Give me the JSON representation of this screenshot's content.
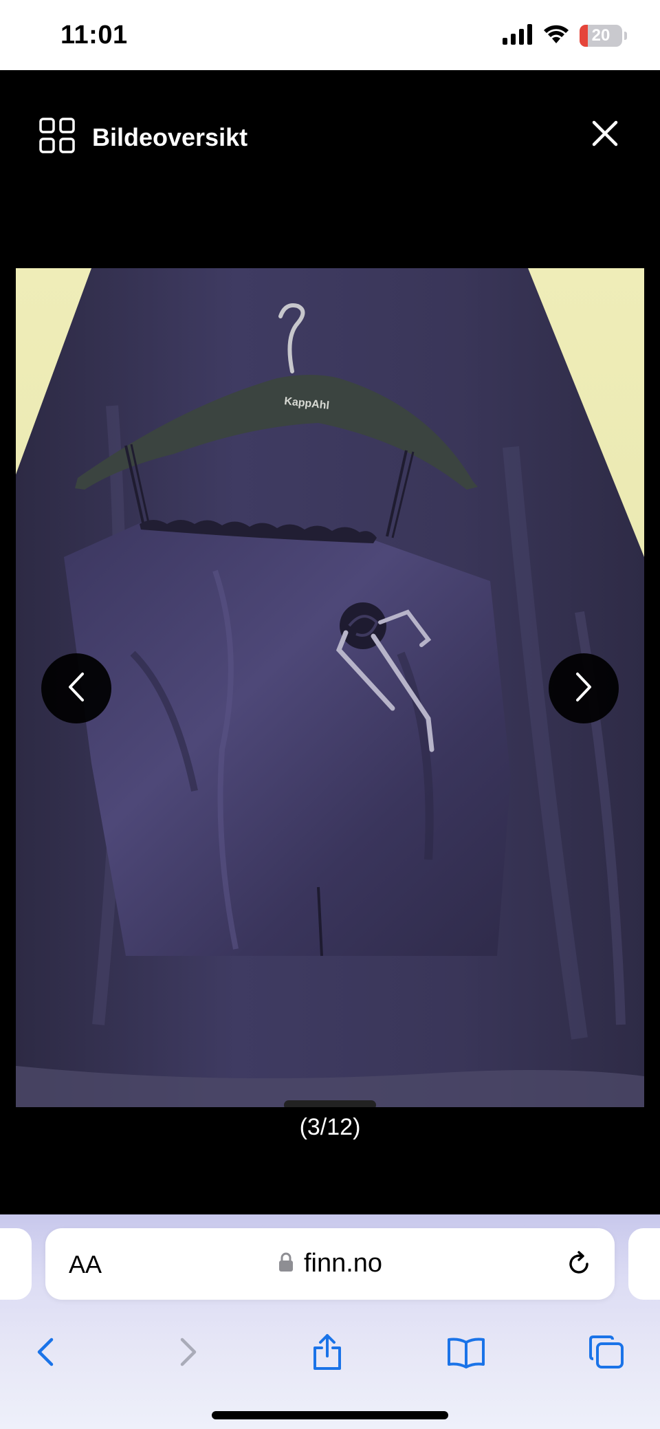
{
  "status_bar": {
    "time": "11:01",
    "battery_level": "20",
    "battery_fraction": 0.2,
    "battery_color": "#e5453a",
    "icons": [
      "cellular-signal-icon",
      "wifi-icon",
      "battery-icon"
    ]
  },
  "viewer": {
    "overview_label": "Bildeoversikt",
    "overview_icon": "grid-icon",
    "close_icon": "close-icon",
    "image_counter": "(3/12)",
    "current_image": 3,
    "total_images": 12,
    "hanger_brand": "KappAhl",
    "prev_icon": "chevron-left-icon",
    "next_icon": "chevron-right-icon"
  },
  "browser": {
    "aa_label": "AA",
    "url": "finn.no",
    "lock_icon": "lock-icon",
    "reload_icon": "reload-icon",
    "toolbar_icons": [
      "back-icon",
      "forward-icon",
      "share-icon",
      "bookmarks-icon",
      "tabs-icon"
    ],
    "accent_color": "#1a73e8"
  }
}
